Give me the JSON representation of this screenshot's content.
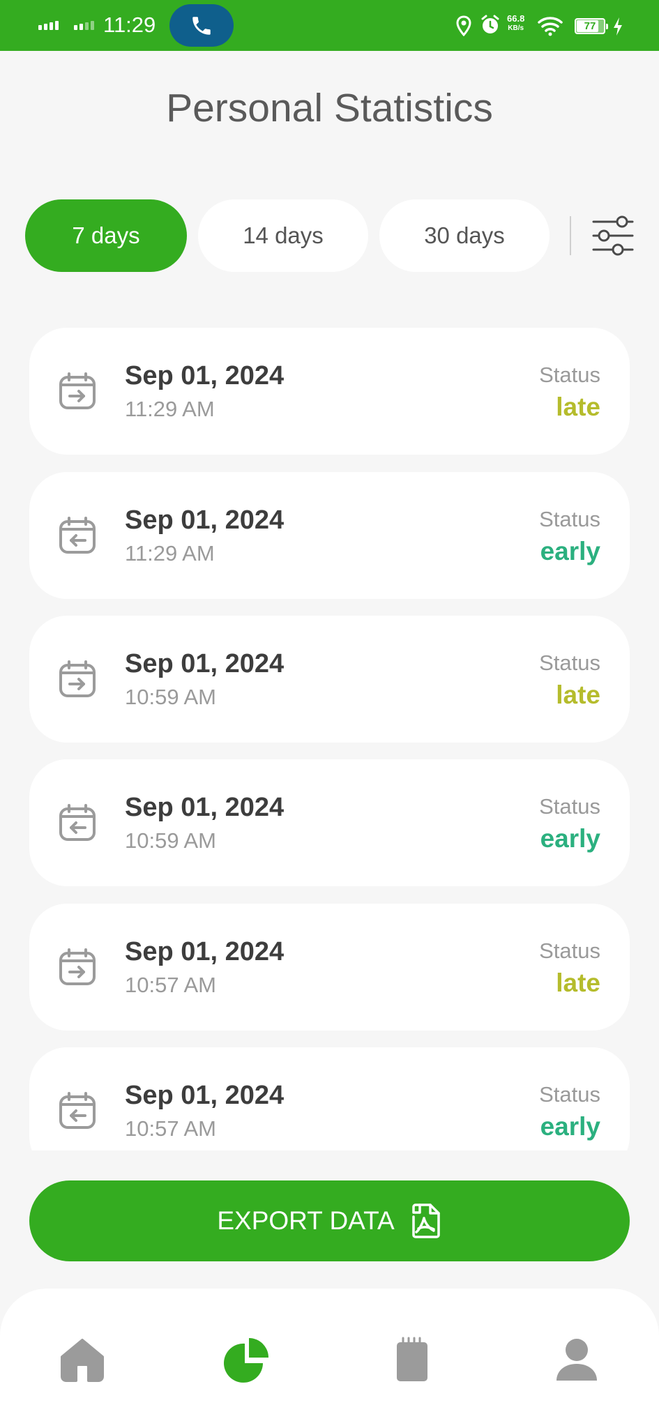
{
  "status_bar": {
    "time": "11:29",
    "net_speed_value": "66.8",
    "net_speed_unit": "KB/s",
    "battery_level": "77"
  },
  "page": {
    "title": "Personal Statistics"
  },
  "tabs": [
    {
      "label": "7 days",
      "active": true
    },
    {
      "label": "14 days",
      "active": false
    },
    {
      "label": "30 days",
      "active": false
    }
  ],
  "records": [
    {
      "direction": "in",
      "date": "Sep 01, 2024",
      "time": "11:29 AM",
      "status_label": "Status",
      "status": "late"
    },
    {
      "direction": "out",
      "date": "Sep 01, 2024",
      "time": "11:29 AM",
      "status_label": "Status",
      "status": "early"
    },
    {
      "direction": "in",
      "date": "Sep 01, 2024",
      "time": "10:59 AM",
      "status_label": "Status",
      "status": "late"
    },
    {
      "direction": "out",
      "date": "Sep 01, 2024",
      "time": "10:59 AM",
      "status_label": "Status",
      "status": "early"
    },
    {
      "direction": "in",
      "date": "Sep 01, 2024",
      "time": "10:57 AM",
      "status_label": "Status",
      "status": "late"
    },
    {
      "direction": "out",
      "date": "Sep 01, 2024",
      "time": "10:57 AM",
      "status_label": "Status",
      "status": "early"
    }
  ],
  "export": {
    "label": "EXPORT DATA"
  },
  "bottom_nav": [
    {
      "name": "home",
      "icon": "home-icon",
      "active": false
    },
    {
      "name": "statistics",
      "icon": "pie-chart-icon",
      "active": true
    },
    {
      "name": "notes",
      "icon": "notepad-icon",
      "active": false
    },
    {
      "name": "profile",
      "icon": "user-icon",
      "active": false
    }
  ],
  "colors": {
    "accent": "#34ac20",
    "late": "#b5bc2c",
    "early": "#2bb07f",
    "icon_gray": "#9b9b9b"
  }
}
